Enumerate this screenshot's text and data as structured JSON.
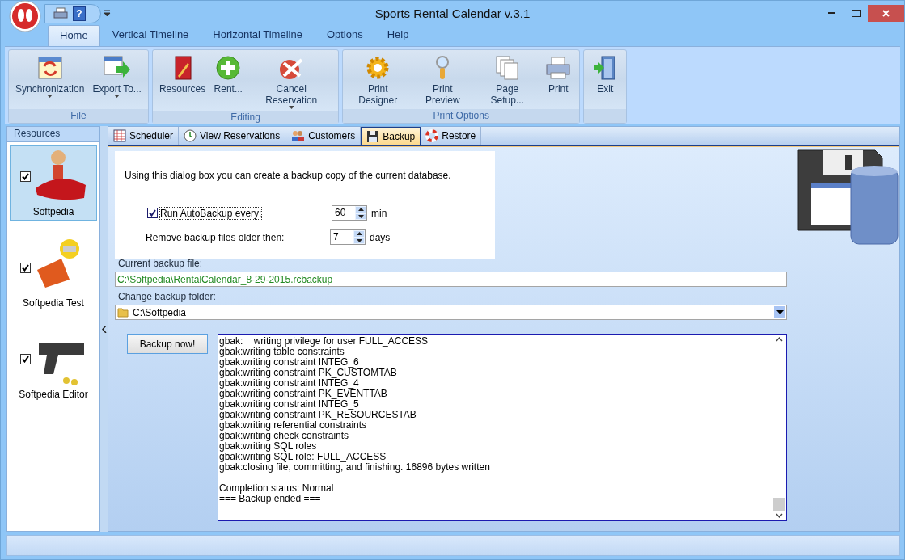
{
  "window": {
    "title": "Sports Rental Calendar v.3.1"
  },
  "quick_access": {
    "help_glyph": "?"
  },
  "ribbon": {
    "tabs": [
      {
        "label": "Home",
        "selected": true
      },
      {
        "label": "Vertical Timeline",
        "selected": false
      },
      {
        "label": "Horizontal Timeline",
        "selected": false
      },
      {
        "label": "Options",
        "selected": false
      },
      {
        "label": "Help",
        "selected": false
      }
    ],
    "groups": [
      {
        "label": "File",
        "buttons": [
          {
            "label": "Synchronization",
            "dropdown": true
          },
          {
            "label": "Export To...",
            "dropdown": true
          }
        ]
      },
      {
        "label": "Editing",
        "buttons": [
          {
            "label": "Resources",
            "dropdown": false
          },
          {
            "label": "Rent...",
            "dropdown": false
          },
          {
            "label": "Cancel Reservation",
            "dropdown": true
          }
        ]
      },
      {
        "label": "Print Options",
        "buttons": [
          {
            "label": "Print Designer",
            "dropdown": false
          },
          {
            "label": "Print Preview",
            "dropdown": false
          },
          {
            "label": "Page Setup...",
            "dropdown": false
          },
          {
            "label": "Print",
            "dropdown": false
          }
        ]
      },
      {
        "buttons": [
          {
            "label": "Exit",
            "dropdown": false
          }
        ]
      }
    ]
  },
  "resources": {
    "title": "Resources",
    "items": [
      {
        "name": "Softpedia",
        "checked": true,
        "selected": true
      },
      {
        "name": "Softpedia Test",
        "checked": true,
        "selected": false
      },
      {
        "name": "Softpedia Editor",
        "checked": true,
        "selected": false
      }
    ]
  },
  "tabs": [
    {
      "label": "Scheduler",
      "selected": false
    },
    {
      "label": "View Reservations",
      "selected": false
    },
    {
      "label": "Customers",
      "selected": false
    },
    {
      "label": "Backup",
      "selected": true
    },
    {
      "label": "Restore",
      "selected": false
    }
  ],
  "backup": {
    "intro": "Using this dialog box you can create a backup copy of the current database.",
    "autobackup": {
      "label": "Run AutoBackup every:",
      "checked": true,
      "value": "60",
      "unit": "min"
    },
    "remove": {
      "label": "Remove backup files older then:",
      "value": "7",
      "unit": "days"
    },
    "current_file": {
      "label": "Current backup file:",
      "value": "C:\\Softpedia\\RentalCalendar_8-29-2015.rcbackup"
    },
    "folder": {
      "label": "Change backup folder:",
      "value": "C:\\Softpedia"
    },
    "button": "Backup now!",
    "log": {
      "lines": [
        "gbak:    writing privilege for user FULL_ACCESS",
        "gbak:writing table constraints",
        "gbak:writing constraint INTEG_6",
        "gbak:writing constraint PK_CUSTOMTAB",
        "gbak:writing constraint INTEG_4",
        "gbak:writing constraint PK_EVENTTAB",
        "gbak:writing constraint INTEG_5",
        "gbak:writing constraint PK_RESOURCESTAB",
        "gbak:writing referential constraints",
        "gbak:writing check constraints",
        "gbak:writing SQL roles",
        "gbak:writing SQL role: FULL_ACCESS",
        "gbak:closing file, committing, and finishing. 16896 bytes written"
      ],
      "summary": [
        "Completion status: Normal",
        "=== Backup ended ==="
      ]
    }
  }
}
